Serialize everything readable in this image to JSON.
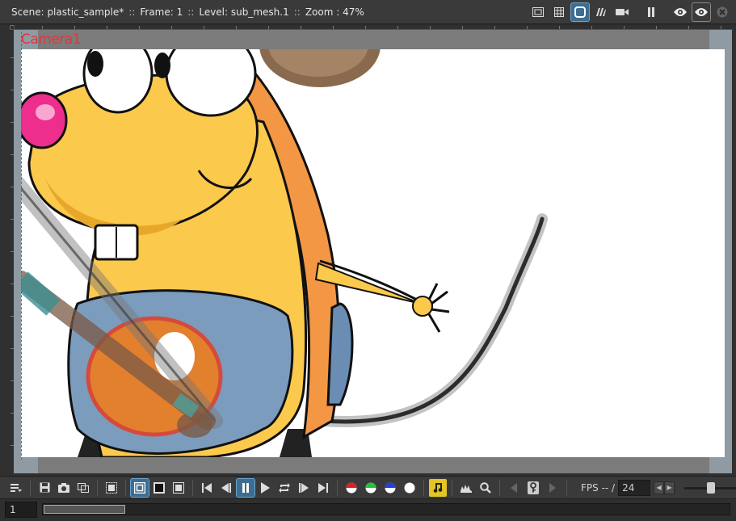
{
  "titlebar": {
    "scene": "Scene: plastic_sample*",
    "frame": "Frame: 1",
    "level": "Level: sub_mesh.1",
    "zoom": "Zoom : 47%",
    "separator": "::",
    "icons": [
      "safe-area-icon",
      "field-guide-icon",
      "camera-view-icon",
      "table-view-icon",
      "camera-stand-icon",
      "freeze-icon",
      "preview-icon",
      "subcamera-preview-icon",
      "close-icon"
    ]
  },
  "viewer": {
    "camera_label": "Camera1"
  },
  "toolbar": {
    "fps_label": "FPS -- /",
    "fps_value": "24",
    "icons": [
      "menu-icon",
      "save-icon",
      "snapshot-icon",
      "compare-icon",
      "define-subcamera-icon",
      "checkerboard-bg-icon",
      "black-bg-icon",
      "white-bg-icon",
      "first-frame-icon",
      "prev-frame-icon",
      "pause-icon",
      "play-icon",
      "loop-icon",
      "next-frame-icon",
      "last-frame-icon",
      "red-channel-icon",
      "green-channel-icon",
      "blue-channel-icon",
      "alpha-channel-icon",
      "sound-icon",
      "histogram-icon",
      "zoom-icon",
      "prev-key-icon",
      "key-icon",
      "next-key-icon"
    ]
  },
  "framebar": {
    "frame_value": "1"
  },
  "colors": {
    "accent": "#3d6e92",
    "camera_label": "#e2353a",
    "sound_active": "#e3c523"
  }
}
